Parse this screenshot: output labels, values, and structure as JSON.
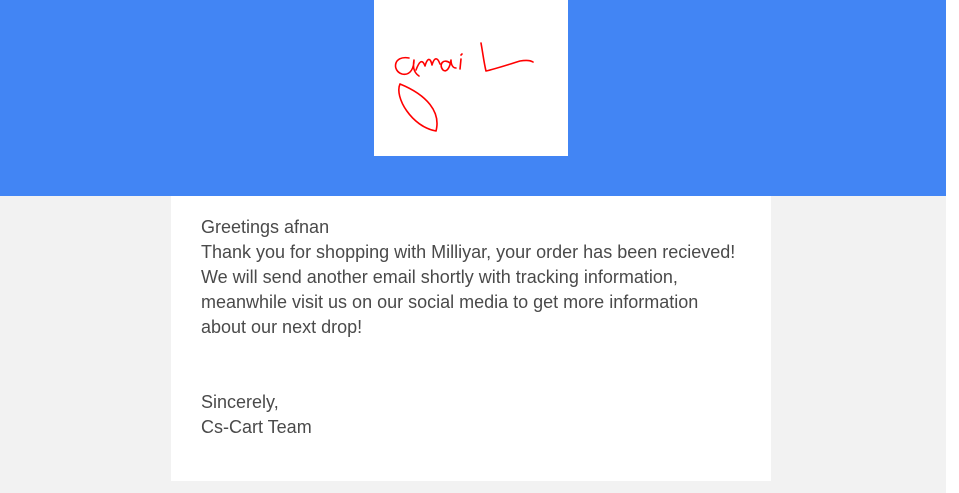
{
  "email": {
    "logo": {
      "signature_text": "gmail",
      "ink_color": "#ff0000"
    },
    "greeting": "Greetings afnan",
    "body_lines": [
      "Thank you for shopping with Milliyar, your order has been recieved!",
      "We will send another email shortly with tracking information,",
      "meanwhile visit us on our social media to get more information",
      "about our next drop!"
    ],
    "closing": "Sincerely,",
    "signature": "Cs-Cart Team"
  },
  "colors": {
    "header": "#4285f4",
    "background": "#f2f2f2",
    "card": "#ffffff",
    "text": "#4a4a4a"
  }
}
